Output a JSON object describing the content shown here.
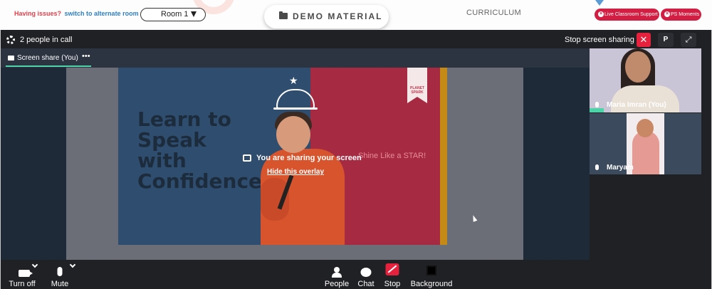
{
  "topbar": {
    "issues_text": "Having issues?",
    "switch_link": "switch to alternate room",
    "room_value": "Room 1",
    "demo_material": "DEMO MATERIAL",
    "curriculum": "CURRICULUM",
    "live_support": "Live Classroom Support",
    "ps_moments": "PS Moments"
  },
  "call": {
    "people_in_call": "2 people in call",
    "stop_screen_sharing": "Stop screen sharing",
    "p_button": "P",
    "share_tab": "Screen share (You)",
    "share_more": "•••"
  },
  "slide": {
    "title": "Learn to\nSpeak\nwith\nConfidence",
    "tagline": "Shine Like a STAR!",
    "brand": "PLANET SPARK"
  },
  "overlay": {
    "message": "You are sharing your screen",
    "hide_link": "Hide this overlay"
  },
  "participants": [
    {
      "name": "Maria Imran (You)"
    },
    {
      "name": "Maryam"
    }
  ],
  "controls": {
    "camera": "Turn off",
    "mic": "Mute",
    "people": "People",
    "chat": "Chat",
    "stop": "Stop",
    "background": "Background"
  },
  "colors": {
    "accent_red": "#e5213d",
    "speaking_green": "#4dd4a9",
    "link_blue": "#2f7fc1",
    "pill_red": "#d21e43"
  }
}
